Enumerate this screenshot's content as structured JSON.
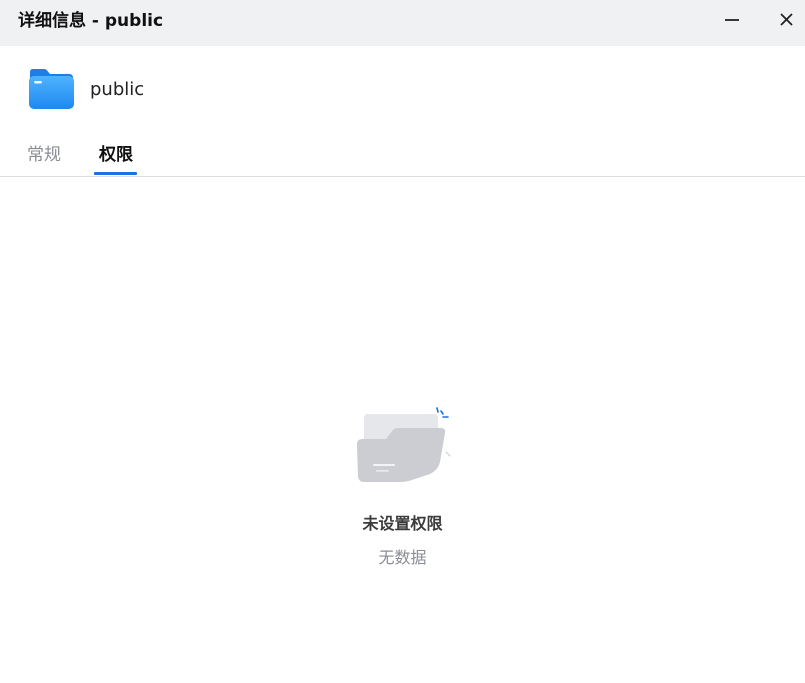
{
  "window": {
    "title": "详细信息 - public"
  },
  "file": {
    "name": "public",
    "icon": "folder-icon",
    "icon_color": "#2e9bf5"
  },
  "tabs": [
    {
      "label": "常规",
      "active": false
    },
    {
      "label": "权限",
      "active": true
    }
  ],
  "empty_state": {
    "title": "未设置权限",
    "subtitle": "无数据",
    "icon": "empty-folder-icon"
  },
  "colors": {
    "accent": "#1f6fde",
    "titlebar_bg": "#f0f1f3",
    "muted_text": "#8a8d93"
  }
}
